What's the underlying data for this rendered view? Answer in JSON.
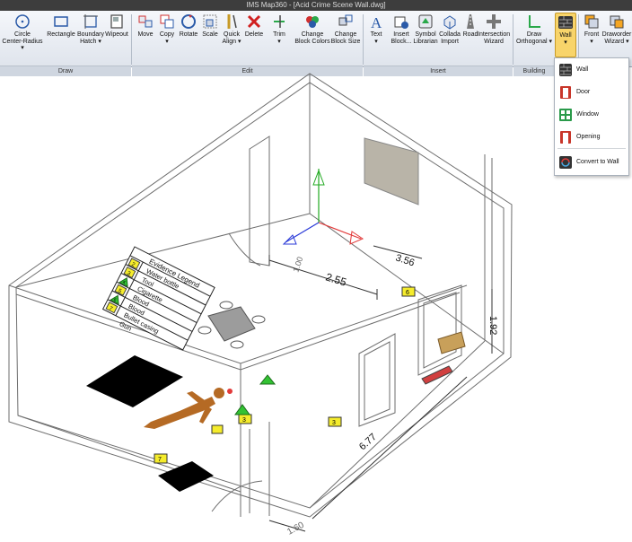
{
  "window": {
    "title": "IMS Map360 - [Acid Crime Scene Wall.dwg]"
  },
  "ribbon": {
    "buttons": [
      {
        "id": "circle",
        "label": "Circle\nCenter-Radius ▾"
      },
      {
        "id": "rectangle",
        "label": "Rectangle"
      },
      {
        "id": "boundary-hatch",
        "label": "Boundary\nHatch ▾"
      },
      {
        "id": "wipeout",
        "label": "Wipeout"
      },
      {
        "id": "move",
        "label": "Move"
      },
      {
        "id": "copy",
        "label": "Copy\n▾"
      },
      {
        "id": "rotate",
        "label": "Rotate"
      },
      {
        "id": "scale",
        "label": "Scale"
      },
      {
        "id": "quick-align",
        "label": "Quick\nAlign ▾"
      },
      {
        "id": "delete",
        "label": "Delete"
      },
      {
        "id": "trim",
        "label": "Trim\n▾"
      },
      {
        "id": "change-block-colors",
        "label": "Change\nBlock Colors"
      },
      {
        "id": "change-block-size",
        "label": "Change\nBlock Size"
      },
      {
        "id": "text",
        "label": "Text\n▾"
      },
      {
        "id": "insert-block",
        "label": "Insert\nBlock..."
      },
      {
        "id": "symbol-librarian",
        "label": "Symbol\nLibrarian"
      },
      {
        "id": "collada-import",
        "label": "Collada\nImport"
      },
      {
        "id": "road",
        "label": "Road"
      },
      {
        "id": "intersection-wizard",
        "label": "Intersection\nWizard"
      },
      {
        "id": "draw-orthogonal",
        "label": "Draw\nOrthogonal ▾"
      },
      {
        "id": "wall",
        "label": "Wall\n▾"
      },
      {
        "id": "front",
        "label": "Front\n▾"
      },
      {
        "id": "draworder-wizard",
        "label": "Draworder\nWizard ▾"
      }
    ],
    "groups": [
      {
        "id": "draw",
        "label": "Draw"
      },
      {
        "id": "edit",
        "label": "Edit"
      },
      {
        "id": "insert",
        "label": "Insert"
      },
      {
        "id": "building",
        "label": "Building"
      }
    ]
  },
  "wall_menu": {
    "items": [
      {
        "id": "wall",
        "label": "Wall",
        "icon": "brick-wall-icon"
      },
      {
        "id": "door",
        "label": "Door",
        "icon": "door-icon"
      },
      {
        "id": "window",
        "label": "Window",
        "icon": "window-icon"
      },
      {
        "id": "opening",
        "label": "Opening",
        "icon": "opening-icon"
      },
      {
        "id": "convert",
        "label": "Convert to Wall",
        "icon": "convert-to-wall-icon"
      }
    ]
  },
  "scene": {
    "dimensions": [
      "3.56",
      "2.55",
      "1.00",
      "1.92",
      "6.77",
      "1.60"
    ],
    "legend": {
      "title": "Evidence Legend",
      "rows": [
        {
          "marker": "2",
          "label": "Water bottle"
        },
        {
          "marker": "3",
          "label": "Tool"
        },
        {
          "marker": "4",
          "label": "Cigarette"
        },
        {
          "marker": "5",
          "label": "Blood"
        },
        {
          "marker": "6",
          "label": "Blood"
        },
        {
          "marker": "7",
          "label": "Bullet casing"
        },
        {
          "marker": "",
          "label": "Gun"
        }
      ]
    },
    "markers": [
      "6",
      "3",
      "3",
      "2",
      "7"
    ],
    "colors": {
      "marker_yellow": "#f5ec2c",
      "marker_green": "#33c233",
      "body": "#b56a24",
      "wall_line": "#6e6e6e",
      "axis_red": "#e23a3a",
      "axis_green": "#22aa22",
      "axis_blue": "#2a3ad8"
    }
  }
}
